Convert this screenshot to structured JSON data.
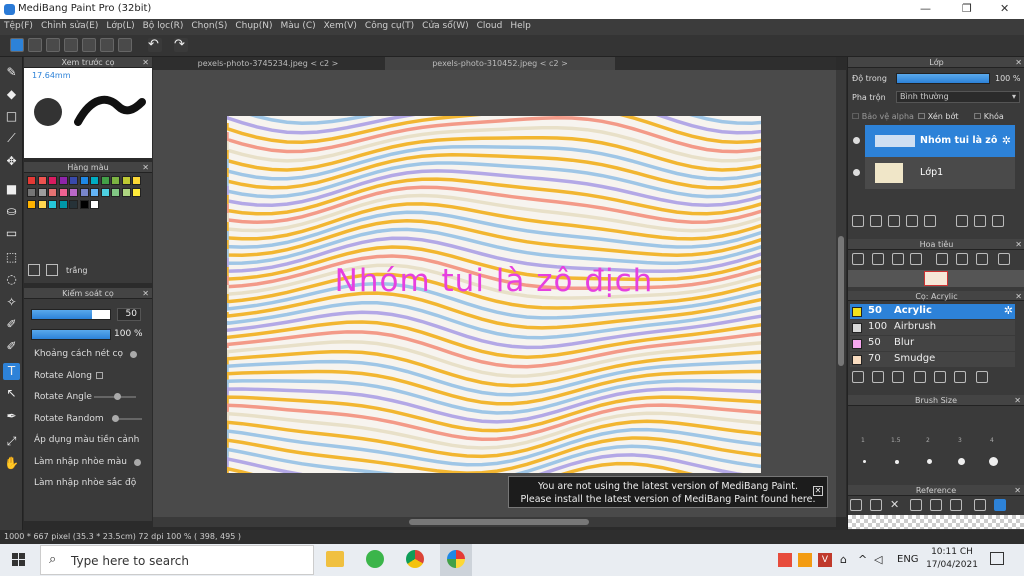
{
  "app": {
    "title": "MediBang Paint Pro (32bit)"
  },
  "menu": [
    "Tệp(F)",
    "Chỉnh sửa(E)",
    "Lớp(L)",
    "Bộ lọc(R)",
    "Chọn(S)",
    "Chụp(N)",
    "Màu (C)",
    "Xem(V)",
    "Công cụ(T)",
    "Cửa sổ(W)",
    "Cloud",
    "Help"
  ],
  "tabs": [
    "pexels-photo-3745234.jpeg < c2 >",
    "pexels-photo-310452.jpeg < c2 >"
  ],
  "preview": {
    "title": "Xem trước cọ",
    "size": "17.64mm"
  },
  "colorpalette": {
    "title": "Hàng màu",
    "name": "trắng",
    "colors": [
      "#e53935",
      "#ef5350",
      "#d81b60",
      "#8e24aa",
      "#3949ab",
      "#1e88e5",
      "#00acc1",
      "#43a047",
      "#7cb342",
      "#c0ca33",
      "#fdd835",
      "#757575",
      "#9e9e9e",
      "#e57373",
      "#f06292",
      "#ba68c8",
      "#7986cb",
      "#64b5f6",
      "#4dd0e1",
      "#81c784",
      "#aed581",
      "#ffeb3b",
      "#ffb300",
      "#ffd54f",
      "#26c6da",
      "#0097a7",
      "#263238",
      "#000000",
      "#ffffff"
    ]
  },
  "brushcontrol": {
    "title": "Kiểm soát cọ",
    "size": "50",
    "opacity": "100 %",
    "options": [
      "Khoảng cách nét cọ",
      "Rotate Along",
      "Rotate Angle",
      "Rotate Random",
      "Áp dụng màu tiền cảnh",
      "Làm nhập nhòe màu",
      "Làm nhập nhòe sắc độ"
    ]
  },
  "canvas": {
    "text": "Nhóm tui là zô địch"
  },
  "layer": {
    "title": "Lớp",
    "opacity_label": "Độ trong",
    "opacity_value": "100 %",
    "blend_label": "Pha trộn",
    "blend_value": "Bình thường",
    "protect_alpha": "Bảo vệ alpha",
    "clipping": "Xén bớt",
    "lock": "Khóa",
    "layers": [
      {
        "name": "Nhóm tui là zô"
      },
      {
        "name": "Lớp1"
      }
    ]
  },
  "navigator": {
    "title": "Hoa tiêu"
  },
  "brushes": {
    "title": "Cọ: Acrylic",
    "items": [
      {
        "size": "50",
        "name": "Acrylic",
        "color": "#f3e21b"
      },
      {
        "size": "100",
        "name": "Airbrush",
        "color": "#d9d9d9"
      },
      {
        "size": "50",
        "name": "Blur",
        "color": "#f7a8f0"
      },
      {
        "size": "70",
        "name": "Smudge",
        "color": "#f9dcc0"
      }
    ]
  },
  "brushsize": {
    "title": "Brush Size",
    "labels": [
      "1",
      "1.5",
      "2",
      "3",
      "4"
    ]
  },
  "reference": {
    "title": "Reference"
  },
  "notice": {
    "line1": "You are not using the latest version of MediBang Paint.",
    "line2": "Please install the latest version of MediBang Paint found here."
  },
  "status": {
    "text": "1000 * 667 pixel  (35.3 * 23.5cm)  72 dpi  100 %  ( 398, 495 )"
  },
  "taskbar": {
    "search": "Type here to search",
    "lang": "ENG",
    "time": "10:11 CH",
    "date": "17/04/2021"
  }
}
